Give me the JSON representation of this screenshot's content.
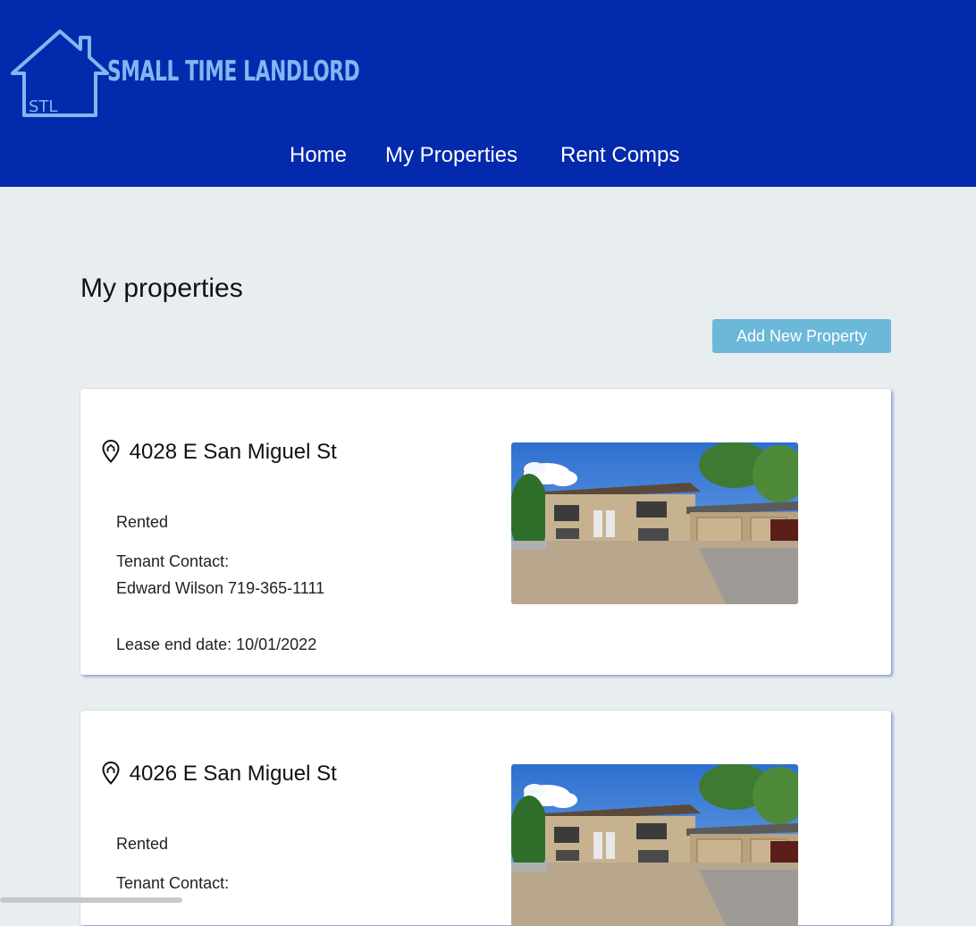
{
  "app": {
    "logo_text": "SMALL TIME LANDLORD",
    "logo_badge": "STL",
    "colors": {
      "header": "#0329ad",
      "logo": "#7fb8f0",
      "button": "#6bb8d8",
      "background": "#e8edf0"
    }
  },
  "nav": {
    "items": [
      {
        "label": "Home"
      },
      {
        "label": "My Properties"
      },
      {
        "label": "Rent Comps"
      }
    ]
  },
  "main": {
    "title": "My properties",
    "add_button": "Add New Property"
  },
  "properties": [
    {
      "address": "4028 E San Miguel St",
      "status": "Rented",
      "contact_label": "Tenant Contact:",
      "contact": "Edward Wilson 719-365-1111",
      "lease": "Lease end date: 10/01/2022",
      "icon": "location-pin-icon"
    },
    {
      "address": "4026 E San Miguel St",
      "status": "Rented",
      "contact_label": "Tenant Contact:",
      "icon": "location-pin-icon"
    }
  ]
}
